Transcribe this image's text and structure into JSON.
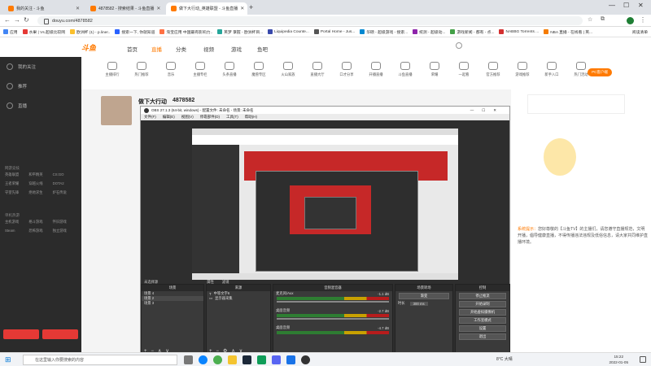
{
  "browser": {
    "tabs": [
      {
        "label": "我的关注 - 斗鱼",
        "active": false
      },
      {
        "label": "4878582 - 搜索结果 - 斗鱼直播",
        "active": false
      },
      {
        "label": "做下大行动_英雄联盟 - 斗鱼直播",
        "active": true
      }
    ],
    "url": "douyu.com/4878582",
    "bookmarks": [
      "应用",
      "水果 | Vs.超级比较网",
      "欧洲杯 (1) - p.liner..",
      "搜索一下, 你就知道",
      "淘宝应用 中国最有影响力..",
      "英梦 掌握 - 欧洲杯目...",
      "Liquipedia Counte...",
      "Portal Home - Jus...",
      "华硕 - 超级游戏 - 搜索...",
      "统测 - 超级动...",
      "游戏新闻 - 都有 - 点...",
      "NABBG Torrents ...",
      "NBA 直播 - 在线看 | 英..."
    ],
    "bookmarks_right": "阅读清单"
  },
  "douyu": {
    "logo": "斗鱼",
    "topnav": [
      "首页",
      "直播",
      "分类",
      "视频",
      "游戏",
      "鱼吧"
    ],
    "left_nav": [
      "我的关注",
      "推荐",
      "直播"
    ],
    "left_sections": [
      {
        "title": "网游竞技",
        "items": [
          "英雄联盟",
          "和平精英",
          "CS:GO",
          "王者荣耀",
          "穿越火线",
          "DOTA2",
          "守望先锋",
          "绝地求生",
          "炉石传说"
        ]
      },
      {
        "title": "单机热游",
        "items": [
          "主机游戏",
          "格斗游戏",
          "怀旧游戏",
          "Steam",
          "恐怖游戏",
          "独立游戏"
        ]
      }
    ],
    "categories": [
      "主播排行",
      "热门推荐",
      "音乐",
      "主播专栏",
      "头条直播",
      "魔兽专区",
      "火山家族",
      "直播大厅",
      "口才分享",
      "开播直播",
      "斗鱼直播",
      "荣耀",
      "一起看",
      "官方推荐",
      "游戏推荐",
      "新手入口",
      "热门活动"
    ],
    "room_title": "做下大行动",
    "room_id": "4878582",
    "pc_button": "PC客户端",
    "notice_prefix": "系统提示：",
    "notice": "您好尊敬的【斗鱼TV】的主播们，请您遵守直播规范，文明开播，倡导健康直播，不得传播违法违规及低俗信息，请大家共同维护直播环境。"
  },
  "obs": {
    "title": "OBS 27.1.3 (64-bit, windows) - 配置文件: 未命名 - 场景: 未命名",
    "menu": [
      "文件(F)",
      "编辑(E)",
      "视图(V)",
      "停靠部件(D)",
      "工具(T)",
      "帮助(H)"
    ],
    "source_label": "未选择源",
    "source_buttons": [
      "属性",
      "滤镜"
    ],
    "docks": {
      "scenes": {
        "title": "场景",
        "items": [
          "场景 4",
          "场景 2",
          "场景 3"
        ],
        "selected": 1
      },
      "sources": {
        "title": "来源",
        "items": [
          "中等文字6",
          "显示器采集"
        ]
      },
      "mixer": {
        "title": "音频混音器",
        "channels": [
          {
            "name": "麦克风/Aux",
            "db": "-1.1 dB"
          },
          {
            "name": "桌面音频",
            "db": "-2.7 dB"
          },
          {
            "name": "桌面音频",
            "db": "-4.7 dB"
          }
        ]
      },
      "transitions": {
        "title": "场景转场",
        "type": "渐变",
        "duration_label": "时长",
        "duration": "300 ms"
      },
      "controls": {
        "title": "控制",
        "buttons": [
          "停止推流",
          "开始录制",
          "开始虚拟摄像机",
          "工作室模式",
          "设置",
          "退出"
        ]
      }
    }
  },
  "taskbar": {
    "search_placeholder": "在这里输入你要搜索的内容",
    "weather": "8°C 大晴",
    "time": "15:22",
    "date": "2022-01-05"
  },
  "colors": {
    "accent": "#ff7a00",
    "obs_bg": "#2e2e2e",
    "douyu_red": "#e53935"
  }
}
